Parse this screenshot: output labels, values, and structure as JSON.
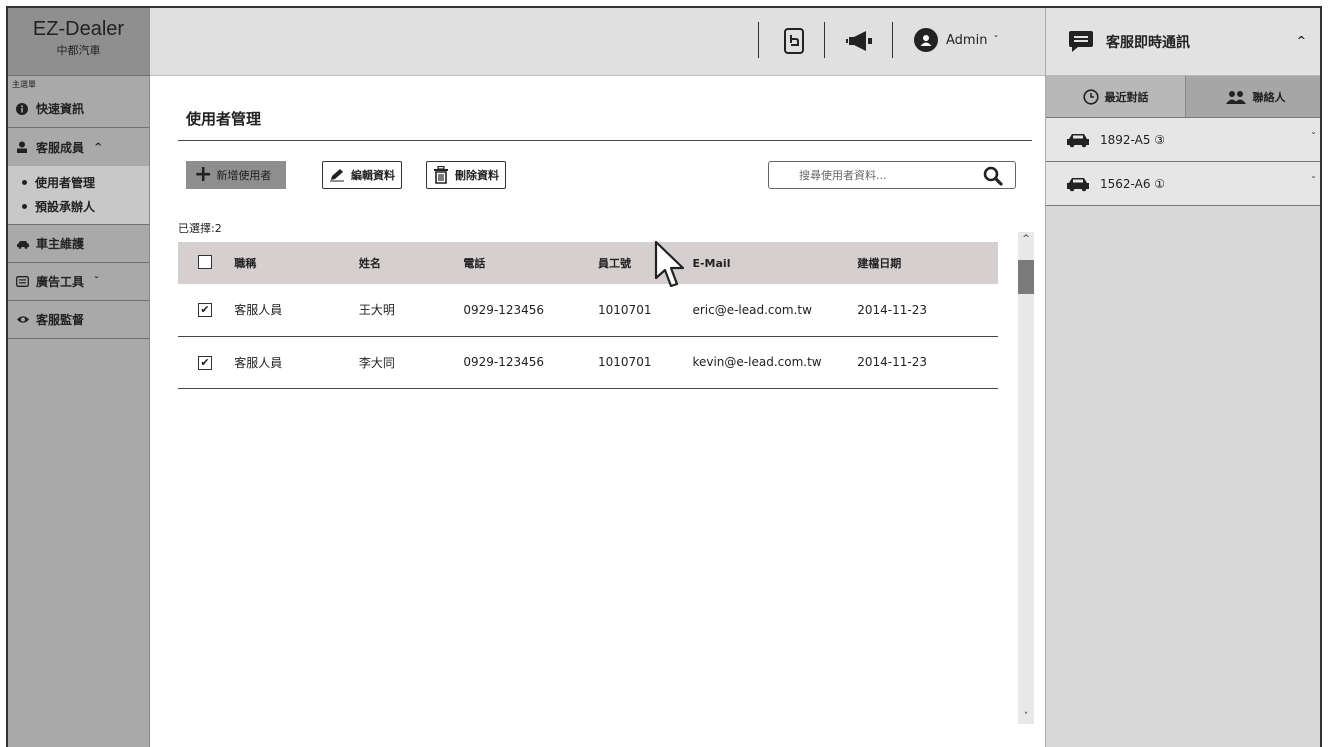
{
  "brand": {
    "title": "EZ-Dealer",
    "subtitle": "中都汽車"
  },
  "sidebar": {
    "caption": "主選單",
    "items": [
      {
        "label": "快速資訊",
        "icon": "info-icon"
      },
      {
        "label": "客服成員",
        "icon": "person-icon",
        "caret": "^"
      },
      {
        "label": "車主維護",
        "icon": "car-icon"
      },
      {
        "label": "廣告工具",
        "icon": "ad-card-icon",
        "caret": "ˇ"
      },
      {
        "label": "客服監督",
        "icon": "eye-icon"
      }
    ],
    "submenu": [
      "使用者管理",
      "預設承辦人"
    ]
  },
  "topbar": {
    "user": "Admin",
    "icons": [
      "tablet-hand-icon",
      "megaphone-icon",
      "user-avatar-icon"
    ]
  },
  "main": {
    "title": "使用者管理",
    "buttons": {
      "add": "新增使用者",
      "edit": "編輯資料",
      "delete": "刪除資料"
    },
    "search_placeholder": "搜尋使用者資料...",
    "selected": "已選擇:2",
    "columns": [
      "職稱",
      "姓名",
      "電話",
      "員工號",
      "E-Mail",
      "建檔日期"
    ],
    "rows": [
      {
        "checked": "✔",
        "title": "客服人員",
        "name": "王大明",
        "phone": "0929-123456",
        "emp": "1010701",
        "email": "eric@e-lead.com.tw",
        "date": "2014-11-23"
      },
      {
        "checked": "✔",
        "title": "客服人員",
        "name": "李大同",
        "phone": "0929-123456",
        "emp": "1010701",
        "email": "kevin@e-lead.com.tw",
        "date": "2014-11-23"
      }
    ]
  },
  "chat": {
    "title": "客服即時通訊",
    "tabs": [
      "最近對話",
      "聯絡人"
    ],
    "conversations": [
      {
        "plate": "1892-A5 ③"
      },
      {
        "plate": "1562-A6 ①"
      }
    ]
  }
}
